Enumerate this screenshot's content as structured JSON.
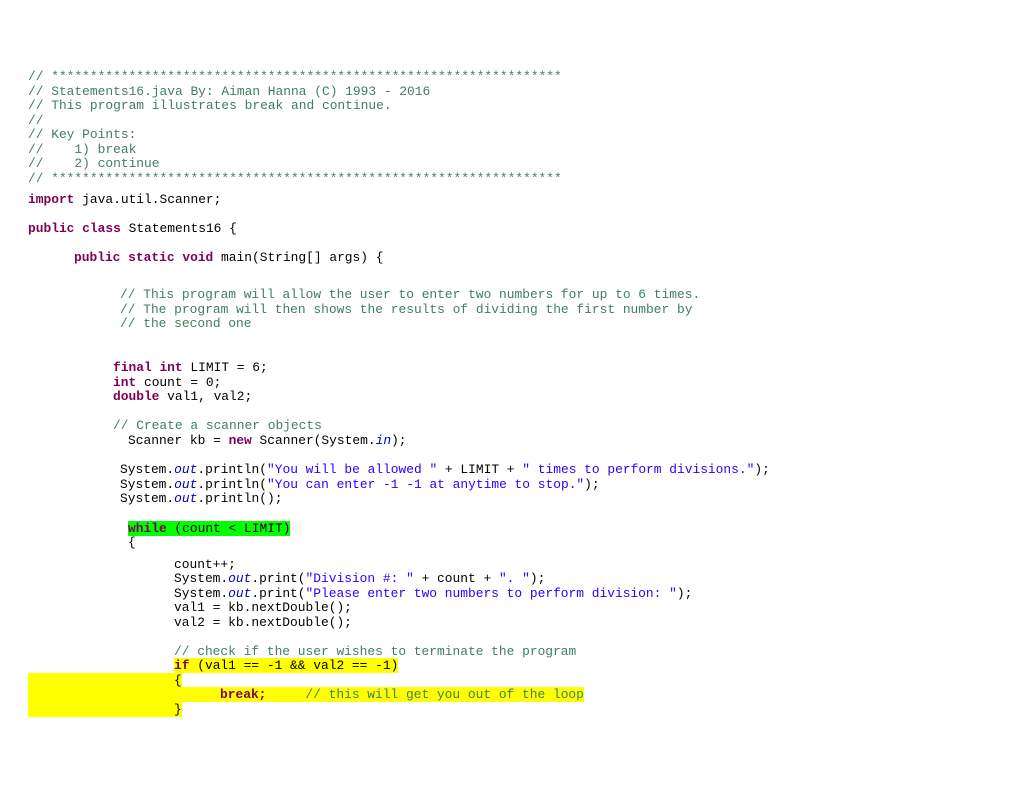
{
  "document": {
    "header_comment": [
      "// ******************************************************************",
      "// Statements16.java By: Aiman Hanna (C) 1993 - 2016",
      "// This program illustrates break and continue.",
      "//",
      "// Key Points:",
      "//    1) break",
      "//    2) continue",
      "// ******************************************************************"
    ],
    "import": {
      "keyword": "import",
      "rest": " java.util.Scanner;"
    },
    "class_decl": {
      "kw1": "public",
      "kw2": "class",
      "rest": " Statements16 {"
    },
    "main_decl": {
      "kw1": "public",
      "kw2": "static",
      "kw3": "void",
      "rest": " main(String[] args) {"
    },
    "intro_comment": [
      "// This program will allow the user to enter two numbers for up to 6 times.",
      "// The program will then shows the results of dividing the first number by",
      "// the second one"
    ],
    "decls": {
      "limit": {
        "kw1": "final",
        "kw2": "int",
        "rest": " LIMIT = 6;"
      },
      "count": {
        "kw": "int",
        "rest": " count = 0;"
      },
      "vals": {
        "kw": "double",
        "rest": " val1, val2;"
      }
    },
    "scanner_comment": "// Create a scanner objects",
    "scanner_line": {
      "pre": "Scanner kb = ",
      "kw": "new",
      "mid": " Scanner(System.",
      "field": "in",
      "post": ");"
    },
    "println_lines": [
      {
        "pre": "System.",
        "field": "out",
        "mid": ".println(",
        "str1": "\"You will be allowed \"",
        "op1": " + LIMIT + ",
        "str2": "\" times to perform divisions.\"",
        "post": ");"
      },
      {
        "pre": "System.",
        "field": "out",
        "mid": ".println(",
        "str1": "\"You can enter -1 -1 at anytime to stop.\"",
        "post": ");"
      },
      {
        "pre": "System.",
        "field": "out",
        "mid": ".println();"
      }
    ],
    "while_line": {
      "kw": "while",
      "rest": " (count < LIMIT)"
    },
    "open_brace": "{",
    "loop_body": {
      "count_inc": "count++;",
      "print_division": {
        "pre": "System.",
        "field": "out",
        "mid": ".print(",
        "str1": "\"Division #: \"",
        "op1": " + count + ",
        "str2": "\". \"",
        "post": ");"
      },
      "print_please": {
        "pre": "System.",
        "field": "out",
        "mid": ".print(",
        "str1": "\"Please enter two numbers to perform division: \"",
        "post": ");"
      },
      "val1": "val1 = kb.nextDouble();",
      "val2": "val2 = kb.nextDouble();",
      "check_comment": "// check if the user wishes to terminate the program",
      "if_line": {
        "kw": "if",
        "rest": " (val1 == -1 && val2 == -1)"
      },
      "if_open": "{",
      "break_kw": "break;",
      "break_comment": "// this will get you out of the loop",
      "if_close": "}"
    },
    "colors": {
      "keyword": "#7f0055",
      "comment": "#3f7f5f",
      "string": "#2a00ff",
      "field": "#0000c0",
      "highlight_green": "#00ff00",
      "highlight_yellow": "#ffff00"
    }
  }
}
